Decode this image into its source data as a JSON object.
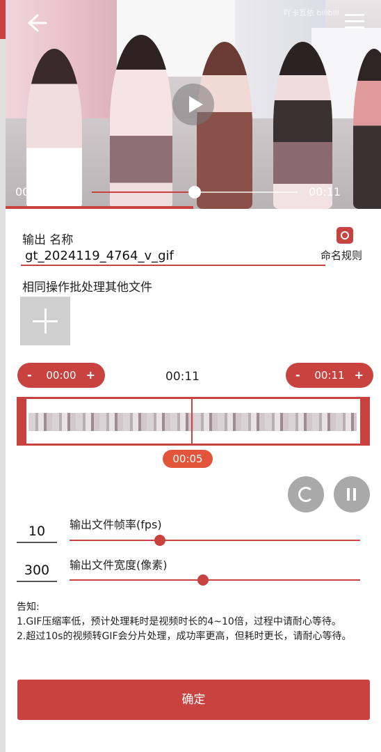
{
  "video": {
    "watermark": "吖卡瓦依 bilibili",
    "current_time": "00:05",
    "end_time": "00:11",
    "progress": 0.5
  },
  "output": {
    "name_label": "输出 名称",
    "name_value": "gt_2024119_4764_v_gif",
    "naming_rule_label": "命名规则",
    "batch_label": "相同操作批处理其他文件"
  },
  "trim": {
    "start": "00:00",
    "end": "00:11",
    "duration": "00:11",
    "minus": "-",
    "plus": "+",
    "cursor_time": "00:05",
    "cursor_position": 0.5
  },
  "params": {
    "fps_value": "10",
    "fps_label": "输出文件帧率(fps)",
    "fps_slider": 0.31,
    "width_value": "300",
    "width_label": "输出文件宽度(像素)",
    "width_slider": 0.46
  },
  "notice": {
    "title": "告知:",
    "line1": "1.GIF压缩率低，预计处理耗时是视频时长的4~10倍，过程中请耐心等待。",
    "line2": "2.超过10s的视频转GIF会分片处理，成功率更高，但耗时更长，请耐心等待。"
  },
  "confirm_label": "确定",
  "colors": {
    "accent": "#c8423f",
    "cursor_badge": "#e2553a"
  }
}
